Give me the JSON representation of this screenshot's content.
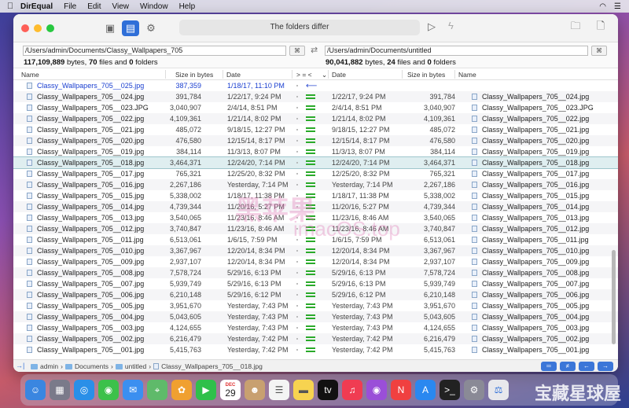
{
  "menubar": {
    "app_name": "DirEqual",
    "items": [
      "File",
      "Edit",
      "View",
      "Window",
      "Help"
    ]
  },
  "toolbar": {
    "status": "The folders differ"
  },
  "left": {
    "path": "/Users/admin/Documents/Classy_Wallpapers_705",
    "bytes": "117,109,889",
    "bytes_label": "bytes,",
    "files": "70",
    "files_label": "files and",
    "folders": "0",
    "folders_label": "folders"
  },
  "right": {
    "path": "/Users/admin/Documents/untitled",
    "bytes": "90,041,882",
    "bytes_label": "bytes,",
    "files": "24",
    "files_label": "files and",
    "folders": "0",
    "folders_label": "folders"
  },
  "columns": {
    "name": "Name",
    "size": "Size in bytes",
    "date": "Date",
    "compare": "> = <",
    "rdate": "Date",
    "rsize": "Size in bytes",
    "rname": "Name"
  },
  "rows": [
    {
      "lname": "Classy_Wallpapers_705__025.jpg",
      "lsize": "387,359",
      "ldate": "1/18/17, 11:10 PM",
      "cmp": "left",
      "rdate": "",
      "rsize": "",
      "rname": ""
    },
    {
      "lname": "Classy_Wallpapers_705__024.jpg",
      "lsize": "391,784",
      "ldate": "1/22/17, 9:24 PM",
      "cmp": "eq",
      "rdate": "1/22/17, 9:24 PM",
      "rsize": "391,784",
      "rname": "Classy_Wallpapers_705__024.jpg"
    },
    {
      "lname": "Classy_Wallpapers_705__023.JPG",
      "lsize": "3,040,907",
      "ldate": "2/4/14, 8:51 PM",
      "cmp": "eq",
      "rdate": "2/4/14, 8:51 PM",
      "rsize": "3,040,907",
      "rname": "Classy_Wallpapers_705__023.JPG"
    },
    {
      "lname": "Classy_Wallpapers_705__022.jpg",
      "lsize": "4,109,361",
      "ldate": "1/21/14, 8:02 PM",
      "cmp": "eq",
      "rdate": "1/21/14, 8:02 PM",
      "rsize": "4,109,361",
      "rname": "Classy_Wallpapers_705__022.jpg"
    },
    {
      "lname": "Classy_Wallpapers_705__021.jpg",
      "lsize": "485,072",
      "ldate": "9/18/15, 12:27 PM",
      "cmp": "eq",
      "rdate": "9/18/15, 12:27 PM",
      "rsize": "485,072",
      "rname": "Classy_Wallpapers_705__021.jpg"
    },
    {
      "lname": "Classy_Wallpapers_705__020.jpg",
      "lsize": "476,580",
      "ldate": "12/15/14, 8:17 PM",
      "cmp": "eq",
      "rdate": "12/15/14, 8:17 PM",
      "rsize": "476,580",
      "rname": "Classy_Wallpapers_705__020.jpg"
    },
    {
      "lname": "Classy_Wallpapers_705__019.jpg",
      "lsize": "384,114",
      "ldate": "11/3/13, 8:07 PM",
      "cmp": "eq",
      "rdate": "11/3/13, 8:07 PM",
      "rsize": "384,114",
      "rname": "Classy_Wallpapers_705__019.jpg"
    },
    {
      "lname": "Classy_Wallpapers_705__018.jpg",
      "lsize": "3,464,371",
      "ldate": "12/24/20, 7:14 PM",
      "cmp": "eq",
      "rdate": "12/24/20, 7:14 PM",
      "rsize": "3,464,371",
      "rname": "Classy_Wallpapers_705__018.jpg",
      "selected": true
    },
    {
      "lname": "Classy_Wallpapers_705__017.jpg",
      "lsize": "765,321",
      "ldate": "12/25/20, 8:32 PM",
      "cmp": "eq",
      "rdate": "12/25/20, 8:32 PM",
      "rsize": "765,321",
      "rname": "Classy_Wallpapers_705__017.jpg"
    },
    {
      "lname": "Classy_Wallpapers_705__016.jpg",
      "lsize": "2,267,186",
      "ldate": "Yesterday, 7:14 PM",
      "cmp": "eq",
      "rdate": "Yesterday, 7:14 PM",
      "rsize": "2,267,186",
      "rname": "Classy_Wallpapers_705__016.jpg"
    },
    {
      "lname": "Classy_Wallpapers_705__015.jpg",
      "lsize": "5,338,002",
      "ldate": "1/18/17, 11:38 PM",
      "cmp": "eq",
      "rdate": "1/18/17, 11:38 PM",
      "rsize": "5,338,002",
      "rname": "Classy_Wallpapers_705__015.jpg"
    },
    {
      "lname": "Classy_Wallpapers_705__014.jpg",
      "lsize": "4,739,344",
      "ldate": "11/20/16, 5:27 PM",
      "cmp": "eq",
      "rdate": "11/20/16, 5:27 PM",
      "rsize": "4,739,344",
      "rname": "Classy_Wallpapers_705__014.jpg"
    },
    {
      "lname": "Classy_Wallpapers_705__013.jpg",
      "lsize": "3,540,065",
      "ldate": "11/23/16, 8:46 AM",
      "cmp": "eq",
      "rdate": "11/23/16, 8:46 AM",
      "rsize": "3,540,065",
      "rname": "Classy_Wallpapers_705__013.jpg"
    },
    {
      "lname": "Classy_Wallpapers_705__012.jpg",
      "lsize": "3,740,847",
      "ldate": "11/23/16, 8:46 AM",
      "cmp": "eq",
      "rdate": "11/23/16, 8:46 AM",
      "rsize": "3,740,847",
      "rname": "Classy_Wallpapers_705__012.jpg"
    },
    {
      "lname": "Classy_Wallpapers_705__011.jpg",
      "lsize": "6,513,061",
      "ldate": "1/6/15, 7:59 PM",
      "cmp": "eq",
      "rdate": "1/6/15, 7:59 PM",
      "rsize": "6,513,061",
      "rname": "Classy_Wallpapers_705__011.jpg"
    },
    {
      "lname": "Classy_Wallpapers_705__010.jpg",
      "lsize": "3,367,967",
      "ldate": "12/20/14, 8:34 PM",
      "cmp": "eq",
      "rdate": "12/20/14, 8:34 PM",
      "rsize": "3,367,967",
      "rname": "Classy_Wallpapers_705__010.jpg"
    },
    {
      "lname": "Classy_Wallpapers_705__009.jpg",
      "lsize": "2,937,107",
      "ldate": "12/20/14, 8:34 PM",
      "cmp": "eq",
      "rdate": "12/20/14, 8:34 PM",
      "rsize": "2,937,107",
      "rname": "Classy_Wallpapers_705__009.jpg"
    },
    {
      "lname": "Classy_Wallpapers_705__008.jpg",
      "lsize": "7,578,724",
      "ldate": "5/29/16, 6:13 PM",
      "cmp": "eq",
      "rdate": "5/29/16, 6:13 PM",
      "rsize": "7,578,724",
      "rname": "Classy_Wallpapers_705__008.jpg"
    },
    {
      "lname": "Classy_Wallpapers_705__007.jpg",
      "lsize": "5,939,749",
      "ldate": "5/29/16, 6:13 PM",
      "cmp": "eq",
      "rdate": "5/29/16, 6:13 PM",
      "rsize": "5,939,749",
      "rname": "Classy_Wallpapers_705__007.jpg"
    },
    {
      "lname": "Classy_Wallpapers_705__006.jpg",
      "lsize": "6,210,148",
      "ldate": "5/29/16, 6:12 PM",
      "cmp": "eq",
      "rdate": "5/29/16, 6:12 PM",
      "rsize": "6,210,148",
      "rname": "Classy_Wallpapers_705__006.jpg"
    },
    {
      "lname": "Classy_Wallpapers_705__005.jpg",
      "lsize": "3,951,670",
      "ldate": "Yesterday, 7:43 PM",
      "cmp": "eq",
      "rdate": "Yesterday, 7:43 PM",
      "rsize": "3,951,670",
      "rname": "Classy_Wallpapers_705__005.jpg"
    },
    {
      "lname": "Classy_Wallpapers_705__004.jpg",
      "lsize": "5,043,605",
      "ldate": "Yesterday, 7:43 PM",
      "cmp": "eq",
      "rdate": "Yesterday, 7:43 PM",
      "rsize": "5,043,605",
      "rname": "Classy_Wallpapers_705__004.jpg"
    },
    {
      "lname": "Classy_Wallpapers_705__003.jpg",
      "lsize": "4,124,655",
      "ldate": "Yesterday, 7:43 PM",
      "cmp": "eq",
      "rdate": "Yesterday, 7:43 PM",
      "rsize": "4,124,655",
      "rname": "Classy_Wallpapers_705__003.jpg"
    },
    {
      "lname": "Classy_Wallpapers_705__002.jpg",
      "lsize": "6,216,479",
      "ldate": "Yesterday, 7:42 PM",
      "cmp": "eq",
      "rdate": "Yesterday, 7:42 PM",
      "rsize": "6,216,479",
      "rname": "Classy_Wallpapers_705__002.jpg"
    },
    {
      "lname": "Classy_Wallpapers_705__001.jpg",
      "lsize": "5,415,763",
      "ldate": "Yesterday, 7:42 PM",
      "cmp": "eq",
      "rdate": "Yesterday, 7:42 PM",
      "rsize": "5,415,763",
      "rname": "Classy_Wallpapers_705__001.jpg"
    }
  ],
  "breadcrumb": [
    "admin",
    "Documents",
    "untitled",
    "Classy_Wallpapers_705__018.jpg"
  ],
  "dock": {
    "calendar_month": "DEC",
    "calendar_day": "29"
  },
  "watermark": {
    "line1": "黑苹果",
    "line2": "imacOS.top",
    "corner": "宝藏星球屋"
  },
  "colors": {
    "accent": "#2f6fd8",
    "equal_green": "#2aaa2a",
    "only_left_blue": "#1a3fd0",
    "selection": "#dfeef0"
  }
}
